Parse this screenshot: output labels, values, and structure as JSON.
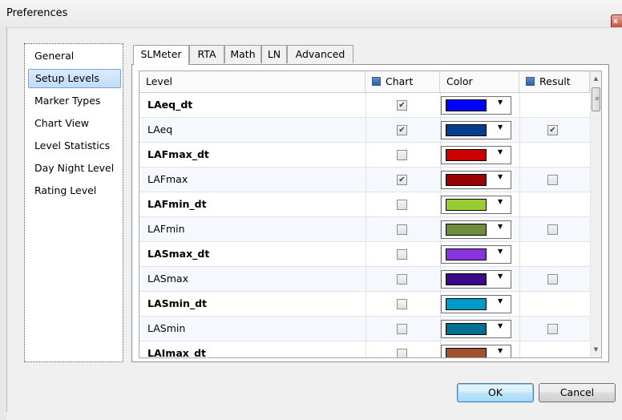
{
  "window": {
    "title": "Preferences",
    "close_glyph": "x"
  },
  "nav": {
    "items": [
      {
        "label": "General",
        "selected": false
      },
      {
        "label": "Setup Levels",
        "selected": true
      },
      {
        "label": "Marker Types",
        "selected": false
      },
      {
        "label": "Chart View",
        "selected": false
      },
      {
        "label": "Level Statistics",
        "selected": false
      },
      {
        "label": "Day Night Level",
        "selected": false
      },
      {
        "label": "Rating Level",
        "selected": false
      }
    ]
  },
  "tabs": [
    {
      "label": "SLMeter",
      "active": true
    },
    {
      "label": "RTA",
      "active": false
    },
    {
      "label": "Math",
      "active": false
    },
    {
      "label": "LN",
      "active": false
    },
    {
      "label": "Advanced",
      "active": false
    }
  ],
  "grid": {
    "headers": {
      "level": "Level",
      "chart": "Chart",
      "color": "Color",
      "result": "Result"
    },
    "rows": [
      {
        "level": "LAeq_dt",
        "bold": true,
        "chart": true,
        "color": "#0000ff",
        "result": null
      },
      {
        "level": "LAeq",
        "bold": false,
        "chart": true,
        "color": "#003f8f",
        "result": true
      },
      {
        "level": "LAFmax_dt",
        "bold": true,
        "chart": false,
        "color": "#cc0000",
        "result": null
      },
      {
        "level": "LAFmax",
        "bold": false,
        "chart": true,
        "color": "#990000",
        "result": false
      },
      {
        "level": "LAFmin_dt",
        "bold": true,
        "chart": false,
        "color": "#99cc33",
        "result": null
      },
      {
        "level": "LAFmin",
        "bold": false,
        "chart": false,
        "color": "#6f8c3f",
        "result": false
      },
      {
        "level": "LASmax_dt",
        "bold": true,
        "chart": false,
        "color": "#8833dd",
        "result": null
      },
      {
        "level": "LASmax",
        "bold": false,
        "chart": false,
        "color": "#3a0a8a",
        "result": false
      },
      {
        "level": "LASmin_dt",
        "bold": true,
        "chart": false,
        "color": "#0099cc",
        "result": null
      },
      {
        "level": "LASmin",
        "bold": false,
        "chart": false,
        "color": "#00708f",
        "result": false
      },
      {
        "level": "LAImax_dt",
        "bold": true,
        "chart": false,
        "color": "#a0522d",
        "result": null
      }
    ]
  },
  "buttons": {
    "ok": "OK",
    "cancel": "Cancel"
  }
}
